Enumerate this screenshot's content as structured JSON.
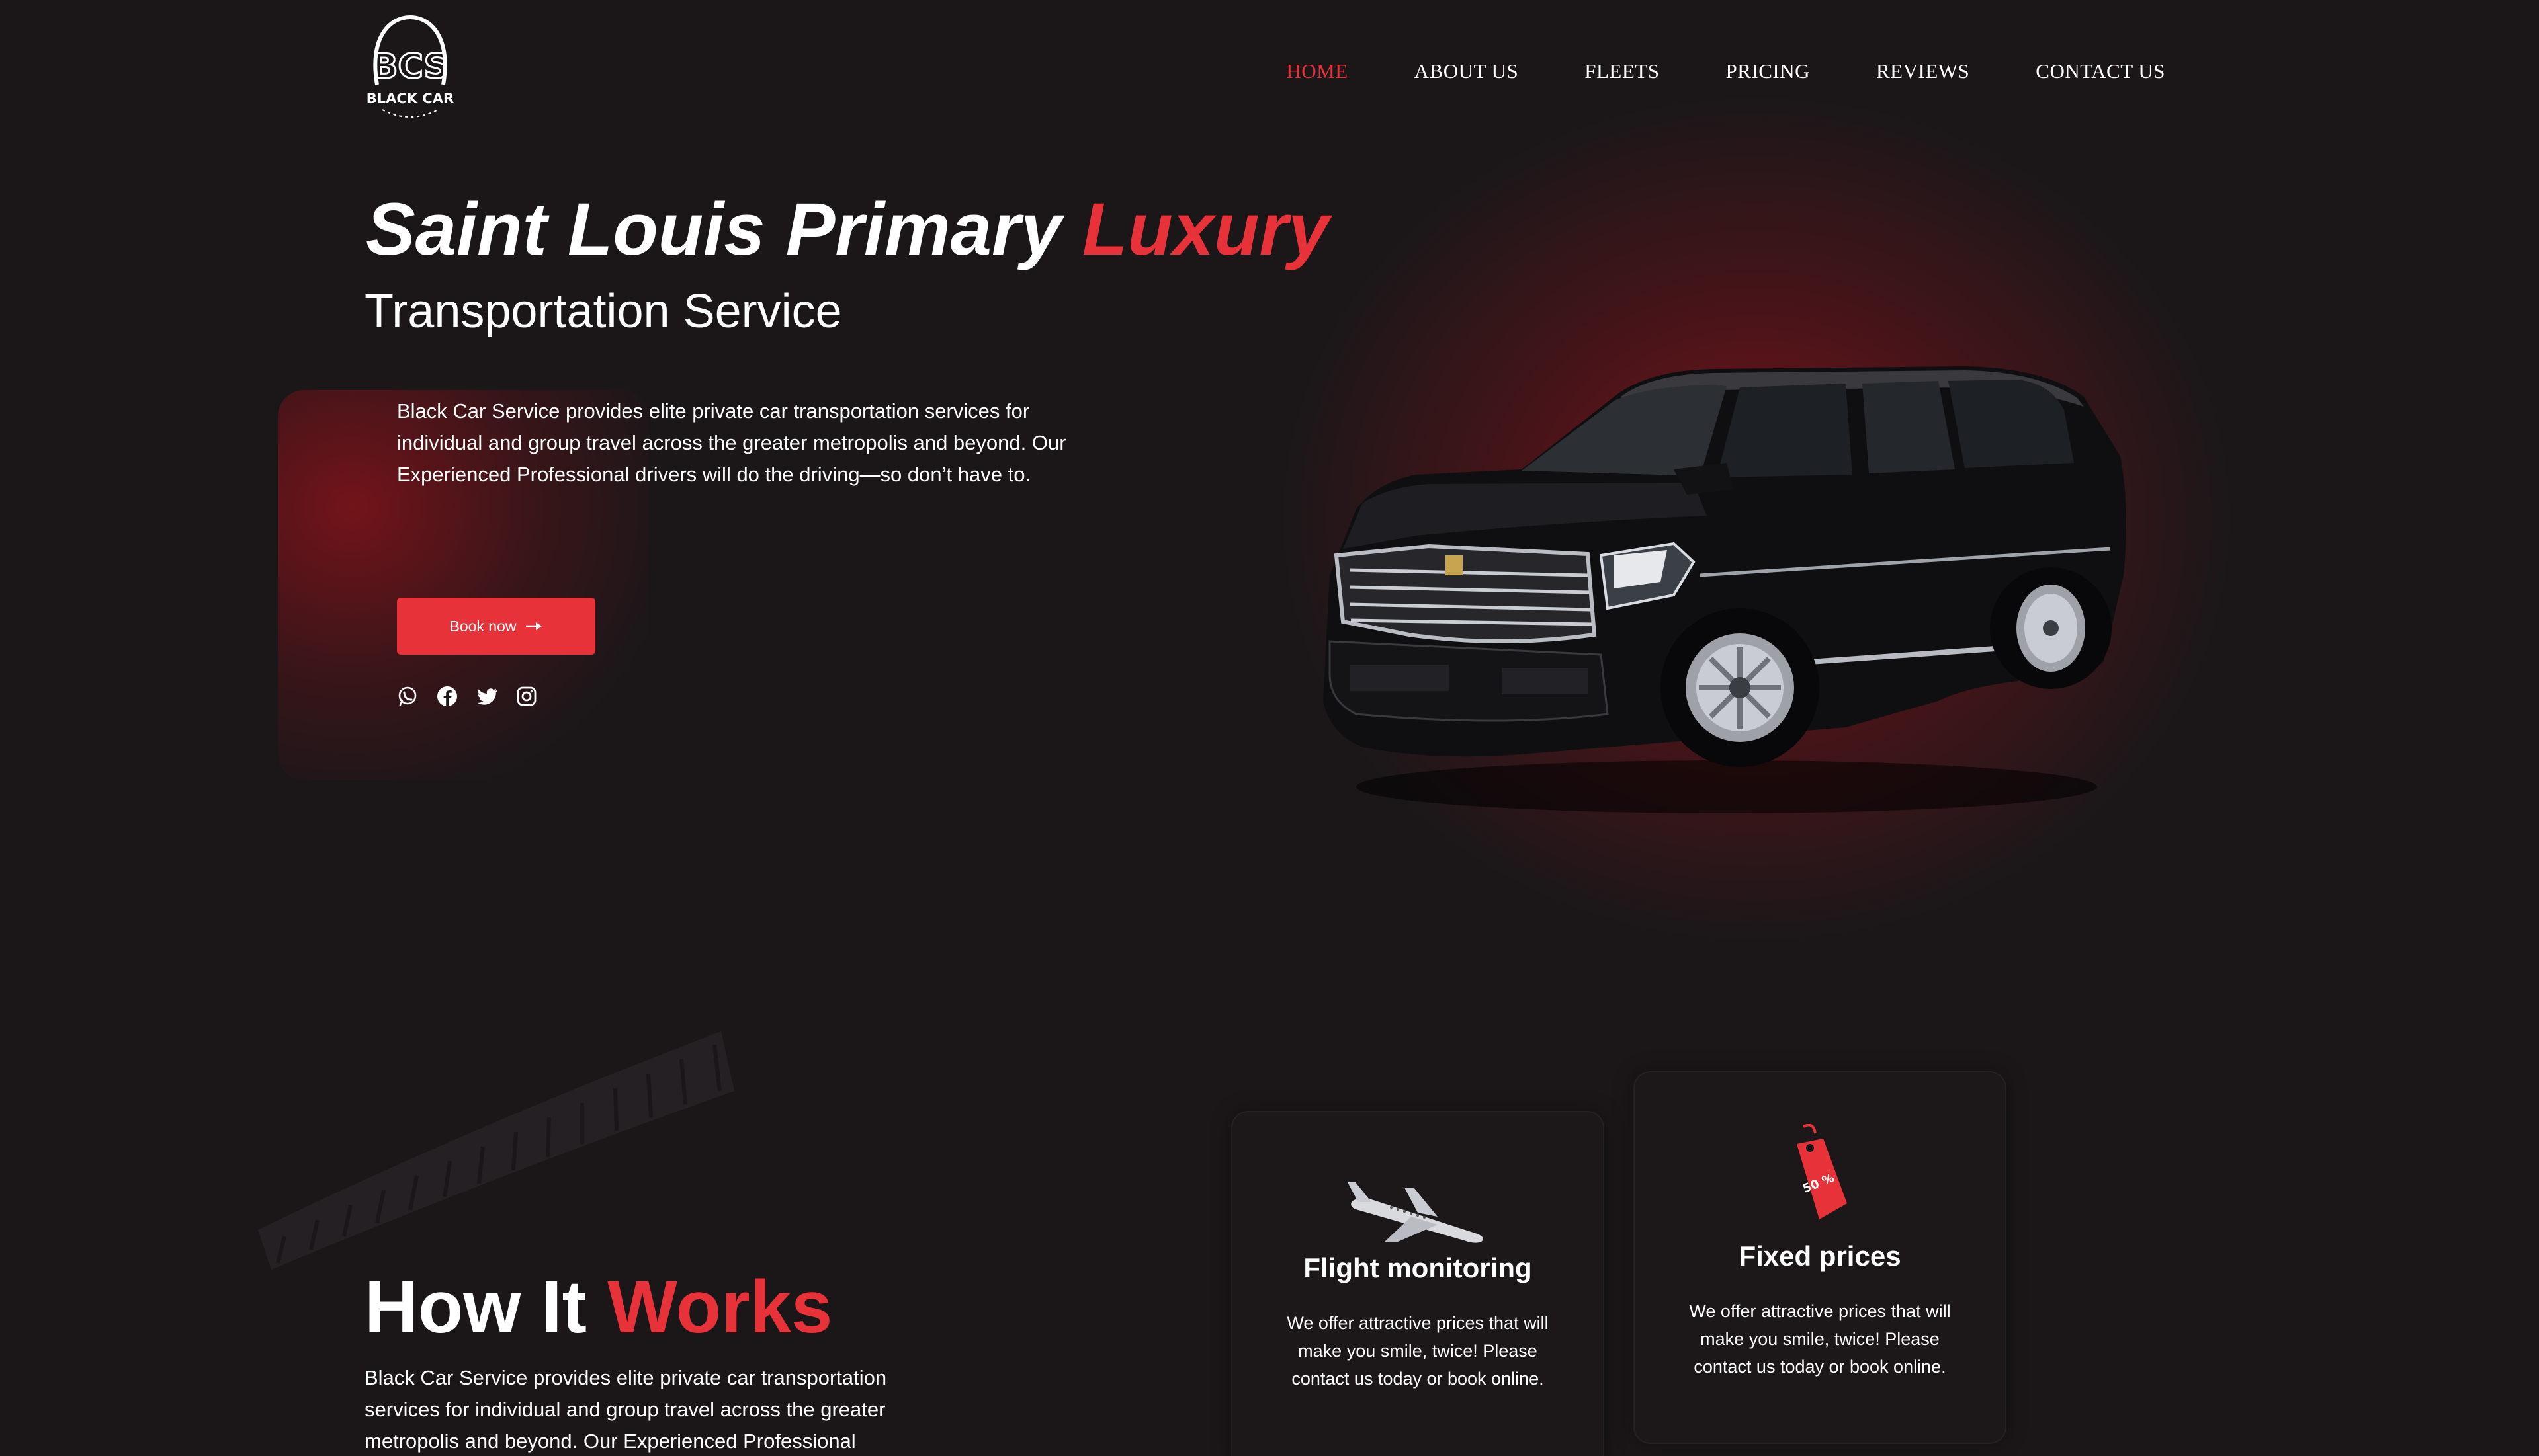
{
  "nav": {
    "items": [
      "HOME",
      "ABOUT US",
      "FLEETS",
      "PRICING",
      "REVIEWS",
      "CONTACT US"
    ],
    "active": "HOME"
  },
  "logo": {
    "text": "BLACK CAR"
  },
  "hero": {
    "title_part1": "Saint Louis Primary ",
    "title_part2": "Luxury",
    "subtitle": "Transportation Service",
    "description": "Black Car Service provides elite private car transportation services for individual and group travel across the greater metropolis and beyond. Our Experienced Professional drivers will do the driving—so don’t have to.",
    "button_label": "Book now",
    "socials": [
      "whatsapp-icon",
      "facebook-icon",
      "twitter-icon",
      "instagram-icon"
    ]
  },
  "how": {
    "title_part1": "How It ",
    "title_part2": "Works",
    "description": "Black Car Service provides elite private car transportation services for individual and group travel across the greater metropolis and beyond. Our Experienced Professional"
  },
  "cards": [
    {
      "title": "Flight monitoring",
      "text": "We offer attractive prices that will make you smile, twice! Please contact us today or book online.",
      "icon": "airplane-icon"
    },
    {
      "title": "Fixed prices",
      "text": "We offer attractive prices that will make you smile, twice! Please contact us today or book online.",
      "icon": "price-tag-icon",
      "tag_text": "50 %"
    }
  ],
  "colors": {
    "accent": "#e8323a",
    "background": "#1b1719",
    "text": "#ffffff"
  }
}
